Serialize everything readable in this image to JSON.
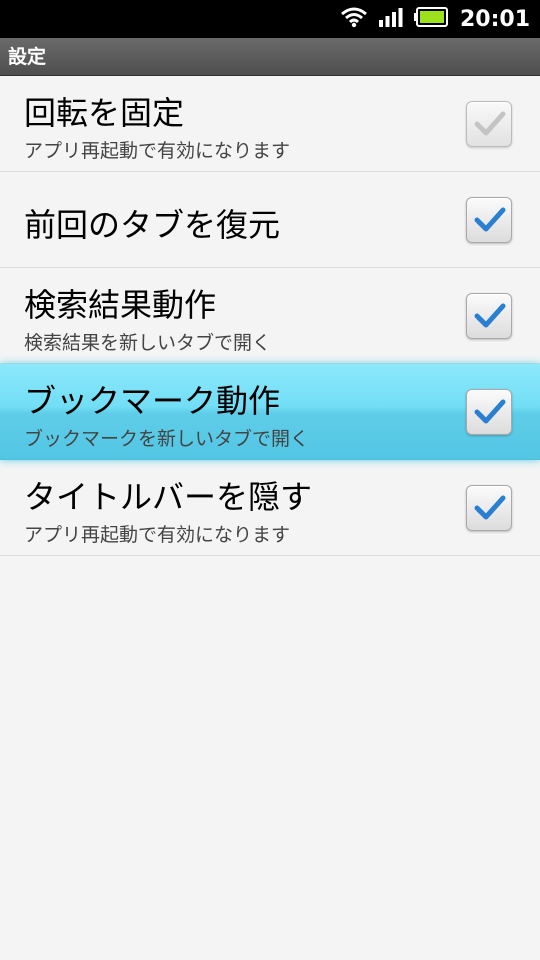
{
  "status_bar": {
    "time": "20:01",
    "icons": [
      "wifi-icon",
      "signal-icon",
      "battery-icon"
    ]
  },
  "title_bar": {
    "title": "設定"
  },
  "settings": [
    {
      "title": "回転を固定",
      "subtitle": "アプリ再起動で有効になります",
      "checked": true,
      "enabled": false,
      "highlighted": false
    },
    {
      "title": "前回のタブを復元",
      "subtitle": "",
      "checked": true,
      "enabled": true,
      "highlighted": false
    },
    {
      "title": "検索結果動作",
      "subtitle": "検索結果を新しいタブで開く",
      "checked": true,
      "enabled": true,
      "highlighted": false
    },
    {
      "title": "ブックマーク動作",
      "subtitle": "ブックマークを新しいタブで開く",
      "checked": true,
      "enabled": true,
      "highlighted": true
    },
    {
      "title": "タイトルバーを隠す",
      "subtitle": "アプリ再起動で有効になります",
      "checked": true,
      "enabled": true,
      "highlighted": false
    }
  ],
  "colors": {
    "check_blue": "#2a7fd0",
    "highlight": "#6edcf4",
    "disabled_check": "#b5b5b5"
  }
}
